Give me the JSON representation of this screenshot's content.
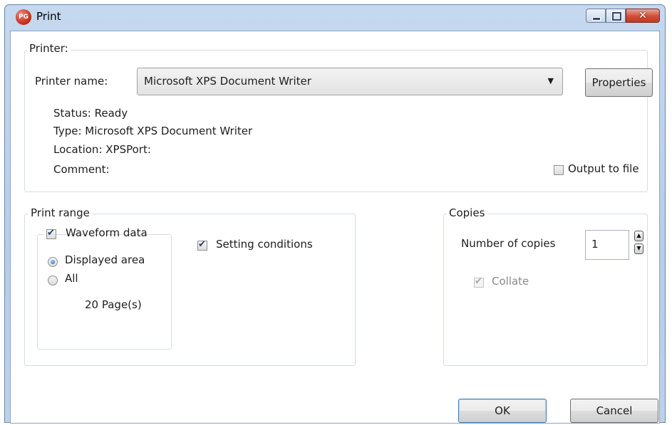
{
  "window": {
    "title": "Print",
    "app_icon_text": "PG"
  },
  "printer": {
    "group_label": "Printer:",
    "name_label": "Printer name:",
    "selected_printer": "Microsoft XPS Document Writer",
    "properties_button": "Properties",
    "status_line": "Status:  Ready",
    "type_line": "Type:  Microsoft XPS Document Writer",
    "location_line": "Location:  XPSPort:",
    "comment_line": "Comment:",
    "output_to_file_label": "Output to file",
    "output_to_file_checked": false
  },
  "print_range": {
    "group_label": "Print range",
    "waveform_data_label": "Waveform data",
    "waveform_data_checked": true,
    "displayed_area_label": "Displayed area",
    "displayed_area_selected": true,
    "all_label": "All",
    "all_selected": false,
    "pages_text": "20 Page(s)",
    "setting_conditions_label": "Setting conditions",
    "setting_conditions_checked": true
  },
  "copies": {
    "group_label": "Copies",
    "number_label": "Number of copies",
    "number_value": "1",
    "collate_label": "Collate",
    "collate_checked": true,
    "collate_enabled": false
  },
  "buttons": {
    "ok": "OK",
    "cancel": "Cancel"
  }
}
